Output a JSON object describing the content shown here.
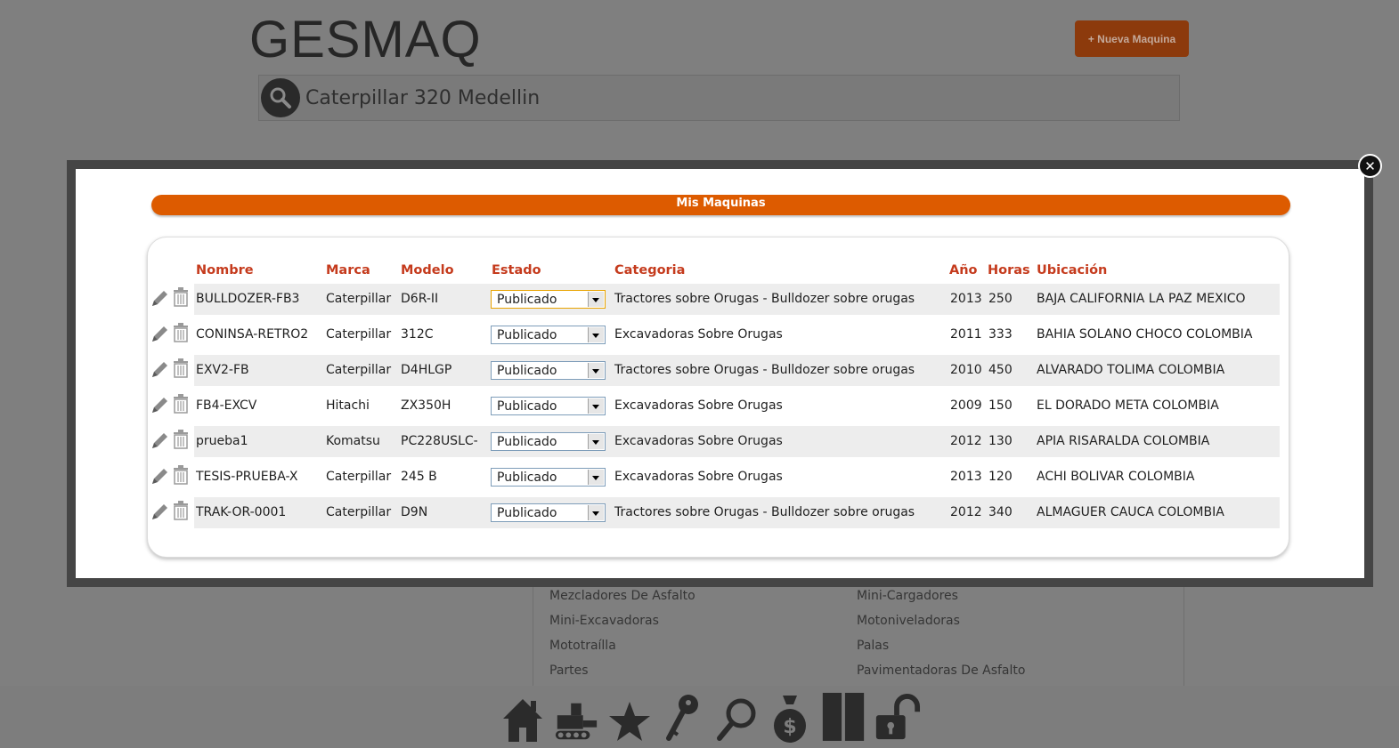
{
  "background": {
    "logo": "GESMAQ",
    "new_machine_button": "+ Nueva Maquina",
    "search_value": "Caterpillar 320 Medellin",
    "categories_left": [
      "Mezcladores De Asfalto",
      "Mini-Excavadoras",
      "Mototraílla",
      "Partes"
    ],
    "categories_right": [
      "Mini-Cargadores",
      "Motoniveladoras",
      "Palas",
      "Pavimentadoras De Asfalto"
    ]
  },
  "modal": {
    "title": "Mis Maquinas",
    "columns": {
      "nombre": "Nombre",
      "marca": "Marca",
      "modelo": "Modelo",
      "estado": "Estado",
      "categoria": "Categoria",
      "anio": "Año",
      "horas": "Horas",
      "ubicacion": "Ubicación"
    },
    "rows": [
      {
        "nombre": "BULLDOZER-FB3",
        "marca": "Caterpillar",
        "modelo": "D6R-II",
        "estado": "Publicado",
        "categoria": "Tractores sobre Orugas - Bulldozer sobre orugas",
        "anio": "2013",
        "horas": "250",
        "ubicacion": "BAJA CALIFORNIA LA PAZ MEXICO"
      },
      {
        "nombre": "CONINSA-RETRO2",
        "marca": "Caterpillar",
        "modelo": "312C",
        "estado": "Publicado",
        "categoria": "Excavadoras Sobre Orugas",
        "anio": "2011",
        "horas": "333",
        "ubicacion": "BAHIA SOLANO CHOCO COLOMBIA"
      },
      {
        "nombre": "EXV2-FB",
        "marca": "Caterpillar",
        "modelo": "D4HLGP",
        "estado": "Publicado",
        "categoria": "Tractores sobre Orugas - Bulldozer sobre orugas",
        "anio": "2010",
        "horas": "450",
        "ubicacion": "ALVARADO TOLIMA COLOMBIA"
      },
      {
        "nombre": "FB4-EXCV",
        "marca": "Hitachi",
        "modelo": "ZX350H",
        "estado": "Publicado",
        "categoria": "Excavadoras Sobre Orugas",
        "anio": "2009",
        "horas": "150",
        "ubicacion": "EL DORADO META COLOMBIA"
      },
      {
        "nombre": "prueba1",
        "marca": "Komatsu",
        "modelo": "PC228USLC-",
        "estado": "Publicado",
        "categoria": "Excavadoras Sobre Orugas",
        "anio": "2012",
        "horas": "130",
        "ubicacion": "APIA RISARALDA COLOMBIA"
      },
      {
        "nombre": "TESIS-PRUEBA-X",
        "marca": "Caterpillar",
        "modelo": "245 B",
        "estado": "Publicado",
        "categoria": "Excavadoras Sobre Orugas",
        "anio": "2013",
        "horas": "120",
        "ubicacion": "ACHI BOLIVAR COLOMBIA"
      },
      {
        "nombre": "TRAK-OR-0001",
        "marca": "Caterpillar",
        "modelo": "D9N",
        "estado": "Publicado",
        "categoria": "Tractores sobre Orugas - Bulldozer sobre orugas",
        "anio": "2012",
        "horas": "340",
        "ubicacion": "ALMAGUER CAUCA COLOMBIA"
      }
    ]
  },
  "bottom_nav": {
    "icons": [
      "home-icon",
      "machine-icon",
      "star-icon",
      "key-icon",
      "search-icon",
      "money-bag-icon",
      "book-icon",
      "unlock-icon"
    ]
  },
  "colors": {
    "accent": "#dd5b00",
    "header_text": "#c53b1d",
    "overlay": "#7f7f7f"
  }
}
